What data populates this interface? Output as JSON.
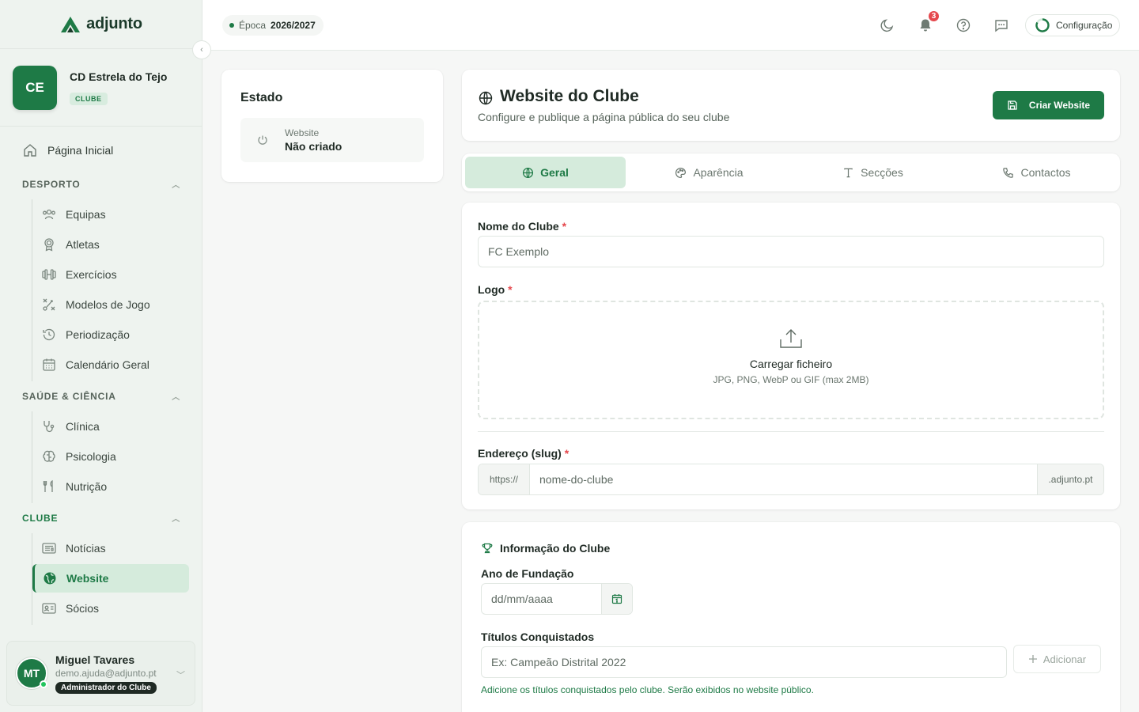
{
  "brand": {
    "name": "adjunto"
  },
  "club": {
    "initials": "CE",
    "name": "CD Estrela do Tejo",
    "badge": "CLUBE"
  },
  "nav": {
    "home": "Página Inicial",
    "sections": [
      {
        "title": "DESPORTO",
        "items": [
          "Equipas",
          "Atletas",
          "Exercícios",
          "Modelos de Jogo",
          "Periodização",
          "Calendário Geral"
        ]
      },
      {
        "title": "SAÚDE & CIÊNCIA",
        "items": [
          "Clínica",
          "Psicologia",
          "Nutrição"
        ]
      },
      {
        "title": "CLUBE",
        "items": [
          "Notícias",
          "Website",
          "Sócios"
        ]
      }
    ],
    "active_item": "Website"
  },
  "user": {
    "initials": "MT",
    "name": "Miguel Tavares",
    "email": "demo.ajuda@adjunto.pt",
    "role": "Administrador do Clube"
  },
  "topbar": {
    "season_label": "Época",
    "season_value": "2026/2027",
    "notifications_count": "3",
    "config_label": "Configuração"
  },
  "status_card": {
    "title": "Estado",
    "item_label": "Website",
    "item_value": "Não criado"
  },
  "page_header": {
    "title": "Website do Clube",
    "subtitle": "Configure e publique a página pública do seu clube",
    "primary_button": "Criar Website"
  },
  "tabs": [
    {
      "label": "Geral",
      "icon": "globe-icon",
      "active": true
    },
    {
      "label": "Aparência",
      "icon": "palette-icon",
      "active": false
    },
    {
      "label": "Secções",
      "icon": "type-icon",
      "active": false
    },
    {
      "label": "Contactos",
      "icon": "phone-icon",
      "active": false
    }
  ],
  "form": {
    "club_name_label": "Nome do Clube",
    "club_name_placeholder": "FC Exemplo",
    "logo_label": "Logo",
    "upload_title": "Carregar ficheiro",
    "upload_hint": "JPG, PNG, WebP ou GIF (max 2MB)",
    "slug_label": "Endereço (slug)",
    "slug_prefix": "https://",
    "slug_placeholder": "nome-do-clube",
    "slug_suffix": ".adjunto.pt",
    "required_mark": "*"
  },
  "info": {
    "title": "Informação do Clube",
    "founded_label": "Ano de Fundação",
    "founded_placeholder": "dd/mm/aaaa",
    "titles_label": "Títulos Conquistados",
    "titles_placeholder": "Ex: Campeão Distrital 2022",
    "add_button": "Adicionar",
    "helper_text": "Adicione os títulos conquistados pelo clube. Serão exibidos no website público."
  },
  "colors": {
    "accent": "#1e7a46",
    "accent_light": "#d5ebdc",
    "danger": "#e5484d"
  }
}
